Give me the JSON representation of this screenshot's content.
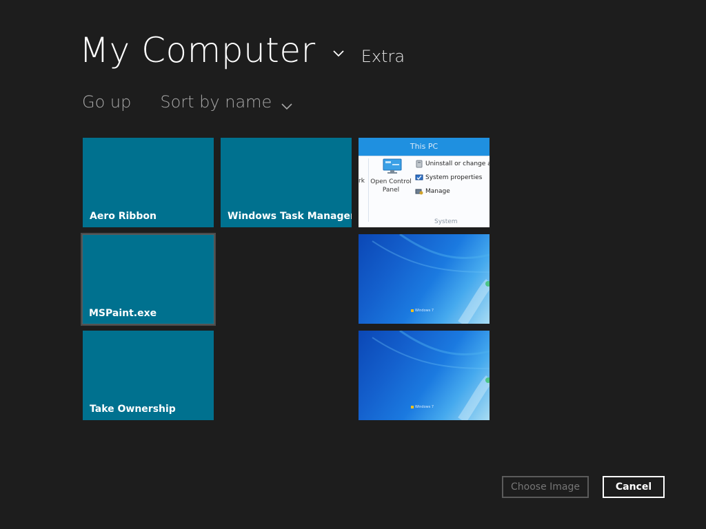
{
  "header": {
    "title": "My Computer",
    "subfolder": "Extra"
  },
  "commands": {
    "go_up": "Go up",
    "sort": "Sort by name"
  },
  "tiles": [
    {
      "label": "Aero Ribbon"
    },
    {
      "label": "Windows Task Manager"
    },
    {
      "label": "MSPaint.exe"
    },
    {
      "label": "Take Ownership"
    }
  ],
  "thumbnail_this_pc": {
    "window_title": "This PC",
    "cut_text": "rk",
    "open_control_panel": "Open Control Panel",
    "items": [
      "Uninstall or change a",
      "System properties",
      "Manage"
    ],
    "group_label": "System"
  },
  "wallpaper_text": "Windows 7",
  "buttons": {
    "choose": "Choose Image",
    "cancel": "Cancel"
  },
  "colors": {
    "background": "#1d1d1d",
    "tile": "#00718f",
    "text": "#ffffff",
    "muted": "#a8a8a8",
    "disabled": "#767676"
  },
  "icons": {
    "title_chevron": "chevron-down-icon",
    "sort_chevron": "chevron-down-icon",
    "control_panel": "control-panel-icon",
    "uninstall": "uninstall-icon",
    "system_properties": "system-properties-icon",
    "manage": "manage-icon"
  }
}
